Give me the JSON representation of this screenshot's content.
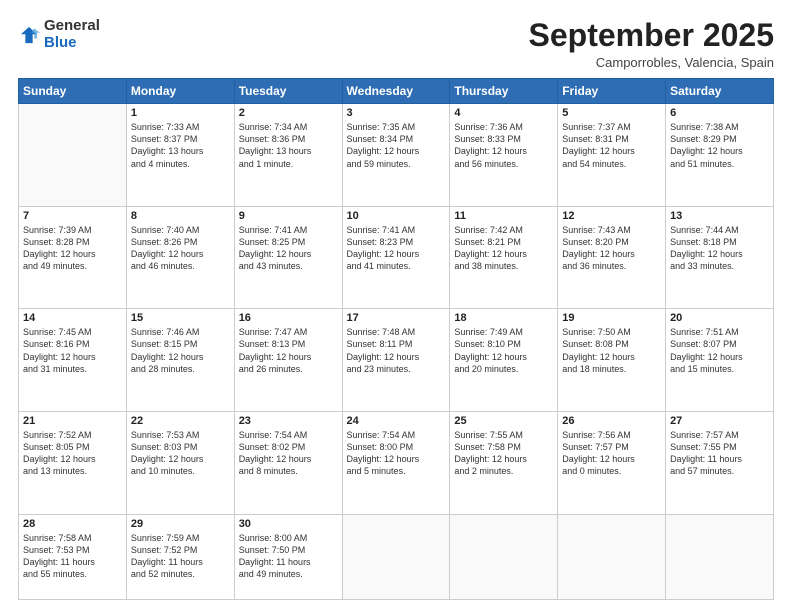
{
  "logo": {
    "general": "General",
    "blue": "Blue"
  },
  "header": {
    "month": "September 2025",
    "location": "Camporrobles, Valencia, Spain"
  },
  "days_of_week": [
    "Sunday",
    "Monday",
    "Tuesday",
    "Wednesday",
    "Thursday",
    "Friday",
    "Saturday"
  ],
  "weeks": [
    [
      {
        "day": "",
        "info": ""
      },
      {
        "day": "1",
        "info": "Sunrise: 7:33 AM\nSunset: 8:37 PM\nDaylight: 13 hours\nand 4 minutes."
      },
      {
        "day": "2",
        "info": "Sunrise: 7:34 AM\nSunset: 8:36 PM\nDaylight: 13 hours\nand 1 minute."
      },
      {
        "day": "3",
        "info": "Sunrise: 7:35 AM\nSunset: 8:34 PM\nDaylight: 12 hours\nand 59 minutes."
      },
      {
        "day": "4",
        "info": "Sunrise: 7:36 AM\nSunset: 8:33 PM\nDaylight: 12 hours\nand 56 minutes."
      },
      {
        "day": "5",
        "info": "Sunrise: 7:37 AM\nSunset: 8:31 PM\nDaylight: 12 hours\nand 54 minutes."
      },
      {
        "day": "6",
        "info": "Sunrise: 7:38 AM\nSunset: 8:29 PM\nDaylight: 12 hours\nand 51 minutes."
      }
    ],
    [
      {
        "day": "7",
        "info": "Sunrise: 7:39 AM\nSunset: 8:28 PM\nDaylight: 12 hours\nand 49 minutes."
      },
      {
        "day": "8",
        "info": "Sunrise: 7:40 AM\nSunset: 8:26 PM\nDaylight: 12 hours\nand 46 minutes."
      },
      {
        "day": "9",
        "info": "Sunrise: 7:41 AM\nSunset: 8:25 PM\nDaylight: 12 hours\nand 43 minutes."
      },
      {
        "day": "10",
        "info": "Sunrise: 7:41 AM\nSunset: 8:23 PM\nDaylight: 12 hours\nand 41 minutes."
      },
      {
        "day": "11",
        "info": "Sunrise: 7:42 AM\nSunset: 8:21 PM\nDaylight: 12 hours\nand 38 minutes."
      },
      {
        "day": "12",
        "info": "Sunrise: 7:43 AM\nSunset: 8:20 PM\nDaylight: 12 hours\nand 36 minutes."
      },
      {
        "day": "13",
        "info": "Sunrise: 7:44 AM\nSunset: 8:18 PM\nDaylight: 12 hours\nand 33 minutes."
      }
    ],
    [
      {
        "day": "14",
        "info": "Sunrise: 7:45 AM\nSunset: 8:16 PM\nDaylight: 12 hours\nand 31 minutes."
      },
      {
        "day": "15",
        "info": "Sunrise: 7:46 AM\nSunset: 8:15 PM\nDaylight: 12 hours\nand 28 minutes."
      },
      {
        "day": "16",
        "info": "Sunrise: 7:47 AM\nSunset: 8:13 PM\nDaylight: 12 hours\nand 26 minutes."
      },
      {
        "day": "17",
        "info": "Sunrise: 7:48 AM\nSunset: 8:11 PM\nDaylight: 12 hours\nand 23 minutes."
      },
      {
        "day": "18",
        "info": "Sunrise: 7:49 AM\nSunset: 8:10 PM\nDaylight: 12 hours\nand 20 minutes."
      },
      {
        "day": "19",
        "info": "Sunrise: 7:50 AM\nSunset: 8:08 PM\nDaylight: 12 hours\nand 18 minutes."
      },
      {
        "day": "20",
        "info": "Sunrise: 7:51 AM\nSunset: 8:07 PM\nDaylight: 12 hours\nand 15 minutes."
      }
    ],
    [
      {
        "day": "21",
        "info": "Sunrise: 7:52 AM\nSunset: 8:05 PM\nDaylight: 12 hours\nand 13 minutes."
      },
      {
        "day": "22",
        "info": "Sunrise: 7:53 AM\nSunset: 8:03 PM\nDaylight: 12 hours\nand 10 minutes."
      },
      {
        "day": "23",
        "info": "Sunrise: 7:54 AM\nSunset: 8:02 PM\nDaylight: 12 hours\nand 8 minutes."
      },
      {
        "day": "24",
        "info": "Sunrise: 7:54 AM\nSunset: 8:00 PM\nDaylight: 12 hours\nand 5 minutes."
      },
      {
        "day": "25",
        "info": "Sunrise: 7:55 AM\nSunset: 7:58 PM\nDaylight: 12 hours\nand 2 minutes."
      },
      {
        "day": "26",
        "info": "Sunrise: 7:56 AM\nSunset: 7:57 PM\nDaylight: 12 hours\nand 0 minutes."
      },
      {
        "day": "27",
        "info": "Sunrise: 7:57 AM\nSunset: 7:55 PM\nDaylight: 11 hours\nand 57 minutes."
      }
    ],
    [
      {
        "day": "28",
        "info": "Sunrise: 7:58 AM\nSunset: 7:53 PM\nDaylight: 11 hours\nand 55 minutes."
      },
      {
        "day": "29",
        "info": "Sunrise: 7:59 AM\nSunset: 7:52 PM\nDaylight: 11 hours\nand 52 minutes."
      },
      {
        "day": "30",
        "info": "Sunrise: 8:00 AM\nSunset: 7:50 PM\nDaylight: 11 hours\nand 49 minutes."
      },
      {
        "day": "",
        "info": ""
      },
      {
        "day": "",
        "info": ""
      },
      {
        "day": "",
        "info": ""
      },
      {
        "day": "",
        "info": ""
      }
    ]
  ]
}
